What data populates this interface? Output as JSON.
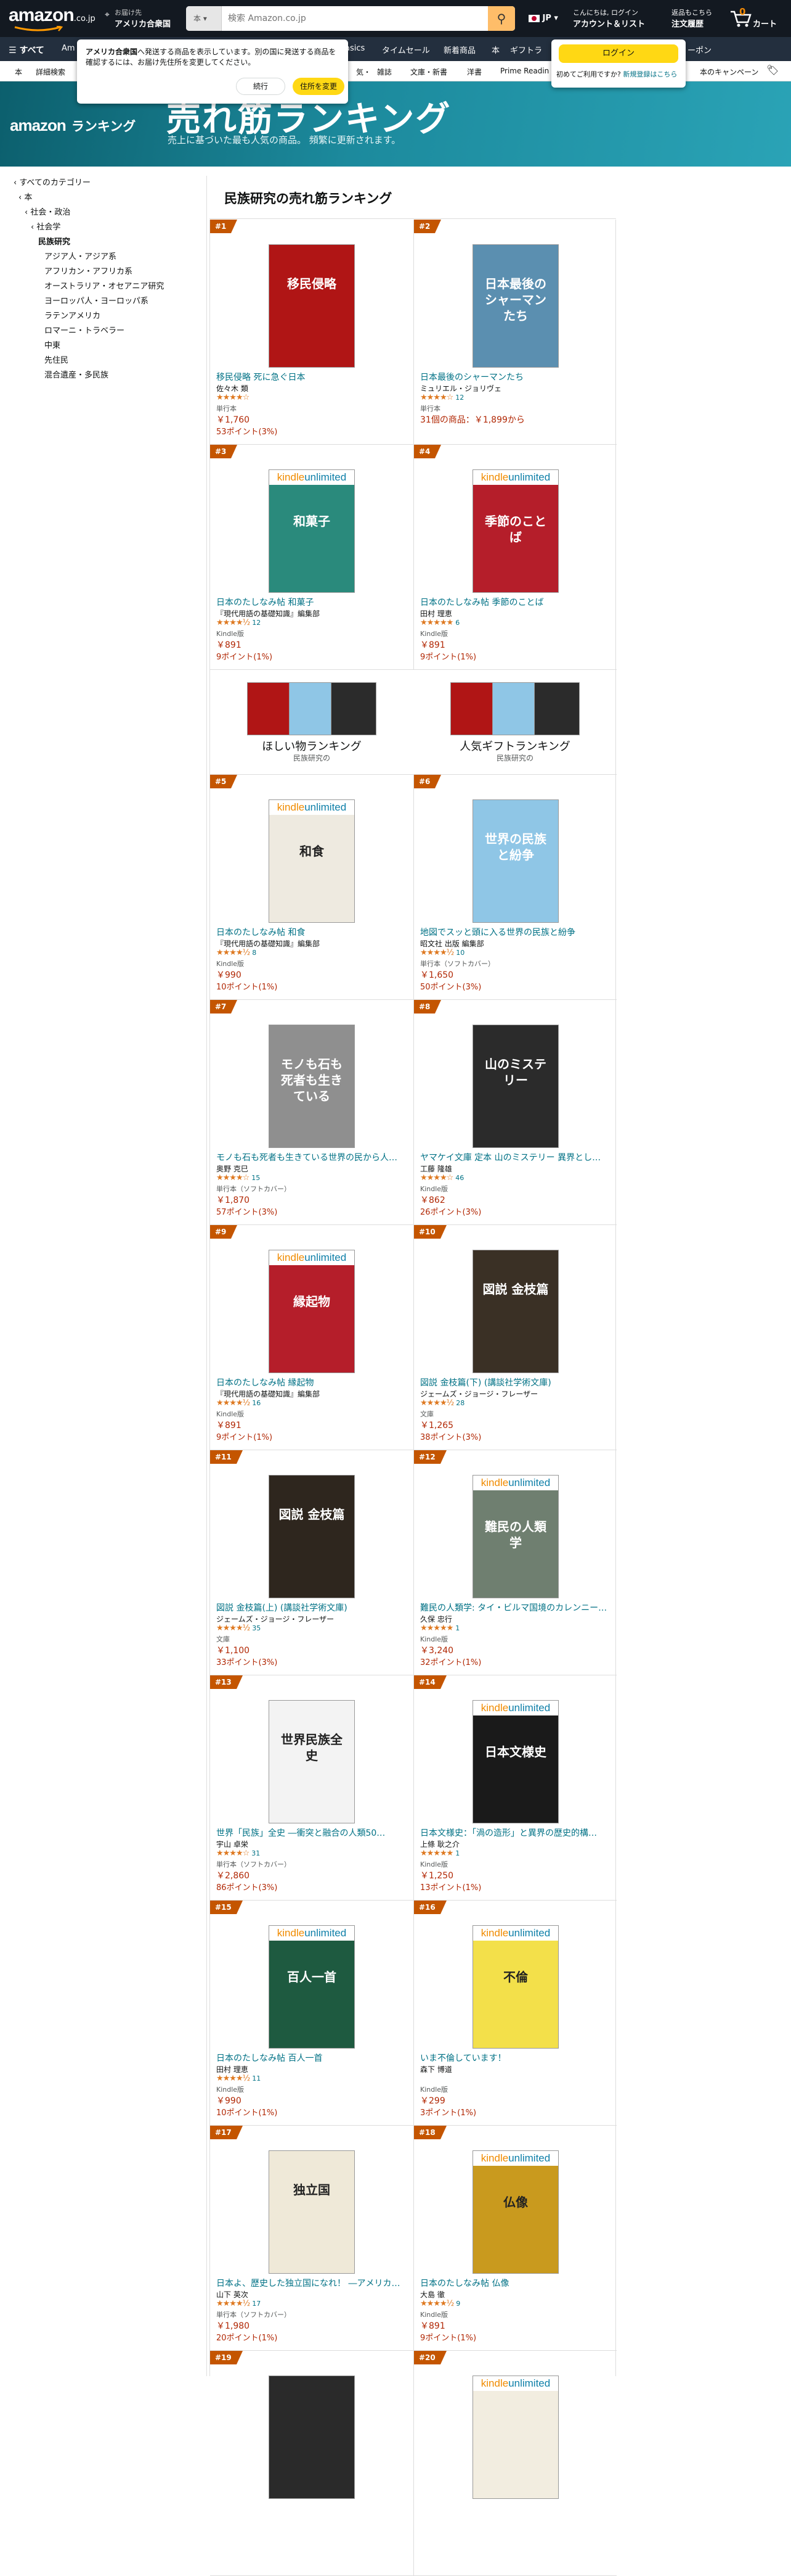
{
  "header": {
    "logo_text": "amazon",
    "logo_suffix": ".co.jp",
    "deliver_line1": "お届け先",
    "deliver_line2": "アメリカ合衆国",
    "search_dept": "本",
    "search_placeholder": "検索 Amazon.co.jp",
    "lang": "JP",
    "account_line1": "こんにちは, ログイン",
    "account_line2": "アカウント＆リスト",
    "orders_line1": "返品もこちら",
    "orders_line2": "注文履歴",
    "cart_count": "0",
    "cart_label": "カート"
  },
  "popup_address": {
    "text_bold": "アメリカ合衆国",
    "text_rest": "へ発送する商品を表示しています。別の国に発送する商品を確認するには、お届け先住所を変更してください。",
    "continue_label": "続行",
    "change_label": "住所を変更"
  },
  "popup_login": {
    "button_label": "ログイン",
    "first_time": "初めてご利用ですか?",
    "register_link": "新規登録はこちら"
  },
  "nav2": {
    "all_label": "すべて",
    "items": [
      "Am",
      "asics",
      "タイムセール",
      "新着商品",
      "本",
      "ギフトラ",
      "ーポン"
    ]
  },
  "nav3": {
    "items": [
      "本",
      "詳細検索",
      "気・",
      "雑誌",
      "文庫・新書",
      "洋書",
      "Prime Reading",
      "本のキャンペーン"
    ]
  },
  "banner": {
    "logo_amazon": "amazon",
    "logo_rank": "ランキング",
    "title": "売れ筋ランキング",
    "subtitle": "売上に基づいた最も人気の商品。 頻繁に更新されます。"
  },
  "sidebar": {
    "items": [
      {
        "label": "‹ すべてのカテゴリー"
      },
      {
        "label": "‹ 本"
      },
      {
        "label": "‹ 社会・政治"
      },
      {
        "label": "‹ 社会学"
      },
      {
        "label": "民族研究"
      },
      {
        "label": "アジア人・アジア系"
      },
      {
        "label": "アフリカン・アフリカ系"
      },
      {
        "label": "オーストラリア・オセアニア研究"
      },
      {
        "label": "ヨーロッパ人・ヨーロッパ系"
      },
      {
        "label": "ラテンアメリカ"
      },
      {
        "label": "ロマーニ・トラベラー"
      },
      {
        "label": "中東"
      },
      {
        "label": "先住民"
      },
      {
        "label": "混合遺産・多民族"
      }
    ]
  },
  "main": {
    "heading": "民族研究の売れ筋ランキング"
  },
  "promos": [
    {
      "title": "ほしい物ランキング",
      "sub": "民族研究の"
    },
    {
      "title": "人気ギフトランキング",
      "sub": "民族研究の"
    }
  ],
  "products": [
    {
      "rank": "#1",
      "title": "移民侵略 死に急ぐ日本",
      "author": "佐々木 類",
      "stars": "★★★★☆",
      "count": "",
      "format": "単行本",
      "price": "￥1,760",
      "points": "53ポイント(3%)",
      "ku": false,
      "cover_text": "移民侵略",
      "cover_bg": "#b01515"
    },
    {
      "rank": "#2",
      "title": "日本最後のシャーマンたち",
      "author": "ミュリエル・ジョリヴェ",
      "stars": "★★★★☆",
      "count": "12",
      "format": "単行本",
      "price": "31個の商品：￥1,899から",
      "points": "",
      "ku": false,
      "cover_text": "日本最後のシャーマンたち",
      "cover_bg": "#5b8fb0"
    },
    {
      "rank": "#3",
      "title": "日本のたしなみ帖 和菓子",
      "author": "『現代用語の基礎知識』編集部",
      "stars": "★★★★½",
      "count": "12",
      "format": "Kindle版",
      "price": "￥891",
      "points": "9ポイント(1%)",
      "ku": true,
      "cover_text": "和菓子",
      "cover_bg": "#2a8a7c"
    },
    {
      "rank": "#4",
      "title": "日本のたしなみ帖 季節のことば",
      "author": "田村 理恵",
      "stars": "★★★★★",
      "count": "6",
      "format": "Kindle版",
      "price": "￥891",
      "points": "9ポイント(1%)",
      "ku": true,
      "cover_text": "季節のことば",
      "cover_bg": "#b51e2a"
    },
    {
      "rank": "#5",
      "title": "日本のたしなみ帖 和食",
      "author": "『現代用語の基礎知識』編集部",
      "stars": "★★★★½",
      "count": "8",
      "format": "Kindle版",
      "price": "￥990",
      "points": "10ポイント(1%)",
      "ku": true,
      "cover_text": "和食",
      "cover_bg": "#eeeae0"
    },
    {
      "rank": "#6",
      "title": "地図でスッと頭に入る世界の民族と紛争",
      "author": "昭文社 出版 編集部",
      "stars": "★★★★½",
      "count": "10",
      "format": "単行本（ソフトカバー）",
      "price": "￥1,650",
      "points": "50ポイント(3%)",
      "ku": false,
      "cover_text": "世界の民族と紛争",
      "cover_bg": "#8fc6e6"
    },
    {
      "rank": "#7",
      "title": "モノも石も死者も生きている世界の民から人…",
      "author": "奥野 克巳",
      "stars": "★★★★☆",
      "count": "15",
      "format": "単行本（ソフトカバー）",
      "price": "￥1,870",
      "points": "57ポイント(3%)",
      "ku": false,
      "cover_text": "モノも石も死者も生きている",
      "cover_bg": "#8f8f8f"
    },
    {
      "rank": "#8",
      "title": "ヤマケイ文庫 定本 山のミステリー 異界とし…",
      "author": "工藤 隆雄",
      "stars": "★★★★☆",
      "count": "46",
      "format": "Kindle版",
      "price": "￥862",
      "points": "26ポイント(3%)",
      "ku": false,
      "cover_text": "山のミステリー",
      "cover_bg": "#2b2b2b"
    },
    {
      "rank": "#9",
      "title": "日本のたしなみ帖 縁起物",
      "author": "『現代用語の基礎知識』編集部",
      "stars": "★★★★½",
      "count": "16",
      "format": "Kindle版",
      "price": "￥891",
      "points": "9ポイント(1%)",
      "ku": true,
      "cover_text": "縁起物",
      "cover_bg": "#b51e2a"
    },
    {
      "rank": "#10",
      "title": "図説 金枝篇(下) (講談社学術文庫)",
      "author": "ジェームズ・ジョージ・フレーザー",
      "stars": "★★★★½",
      "count": "28",
      "format": "文庫",
      "price": "￥1,265",
      "points": "38ポイント(3%)",
      "ku": false,
      "cover_text": "図説 金枝篇",
      "cover_bg": "#3a3025"
    },
    {
      "rank": "#11",
      "title": "図説 金枝篇(上) (講談社学術文庫)",
      "author": "ジェームズ・ジョージ・フレーザー",
      "stars": "★★★★½",
      "count": "35",
      "format": "文庫",
      "price": "￥1,100",
      "points": "33ポイント(3%)",
      "ku": false,
      "cover_text": "図説 金枝篇",
      "cover_bg": "#2e261e"
    },
    {
      "rank": "#12",
      "title": "難民の人類学: タイ・ビルマ国境のカレンニー…",
      "author": "久保 忠行",
      "stars": "★★★★★",
      "count": "1",
      "format": "Kindle版",
      "price": "￥3,240",
      "points": "32ポイント(1%)",
      "ku": true,
      "cover_text": "難民の人類学",
      "cover_bg": "#6f7f70"
    },
    {
      "rank": "#13",
      "title": "世界「民族」全史 ―衝突と融合の人類50…",
      "author": "宇山 卓栄",
      "stars": "★★★★☆",
      "count": "31",
      "format": "単行本（ソフトカバー）",
      "price": "￥2,860",
      "points": "86ポイント(3%)",
      "ku": false,
      "cover_text": "世界民族全史",
      "cover_bg": "#f3f3f3"
    },
    {
      "rank": "#14",
      "title": "日本文様史：「渦の造形」と異界の歴史的構…",
      "author": "上條 耿之介",
      "stars": "★★★★★",
      "count": "1",
      "format": "Kindle版",
      "price": "￥1,250",
      "points": "13ポイント(1%)",
      "ku": true,
      "cover_text": "日本文様史",
      "cover_bg": "#1a1a1a"
    },
    {
      "rank": "#15",
      "title": "日本のたしなみ帖 百人一首",
      "author": "田村 理恵",
      "stars": "★★★★½",
      "count": "11",
      "format": "Kindle版",
      "price": "￥990",
      "points": "10ポイント(1%)",
      "ku": true,
      "cover_text": "百人一首",
      "cover_bg": "#1e5a40"
    },
    {
      "rank": "#16",
      "title": "いま不倫しています！",
      "author": "森下 博道",
      "stars": "",
      "count": "",
      "format": "Kindle版",
      "price": "￥299",
      "points": "3ポイント(1%)",
      "ku": true,
      "cover_text": "不倫",
      "cover_bg": "#f3e04a"
    },
    {
      "rank": "#17",
      "title": "日本よ、歴史した独立国になれ！ ―アメリカ…",
      "author": "山下 英次",
      "stars": "★★★★½",
      "count": "17",
      "format": "単行本（ソフトカバー）",
      "price": "￥1,980",
      "points": "20ポイント(1%)",
      "ku": false,
      "cover_text": "独立国",
      "cover_bg": "#efe9d8"
    },
    {
      "rank": "#18",
      "title": "日本のたしなみ帖 仏像",
      "author": "大島 徹",
      "stars": "★★★★½",
      "count": "9",
      "format": "Kindle版",
      "price": "￥891",
      "points": "9ポイント(1%)",
      "ku": true,
      "cover_text": "仏像",
      "cover_bg": "#c99a1e"
    },
    {
      "rank": "#19",
      "title": "",
      "author": "",
      "stars": "",
      "count": "",
      "format": "",
      "price": "",
      "points": "",
      "ku": false,
      "cover_text": "",
      "cover_bg": "#2a2a2a"
    },
    {
      "rank": "#20",
      "title": "",
      "author": "",
      "stars": "",
      "count": "",
      "format": "",
      "price": "",
      "points": "",
      "ku": true,
      "cover_text": "",
      "cover_bg": "#f2ede0"
    }
  ]
}
